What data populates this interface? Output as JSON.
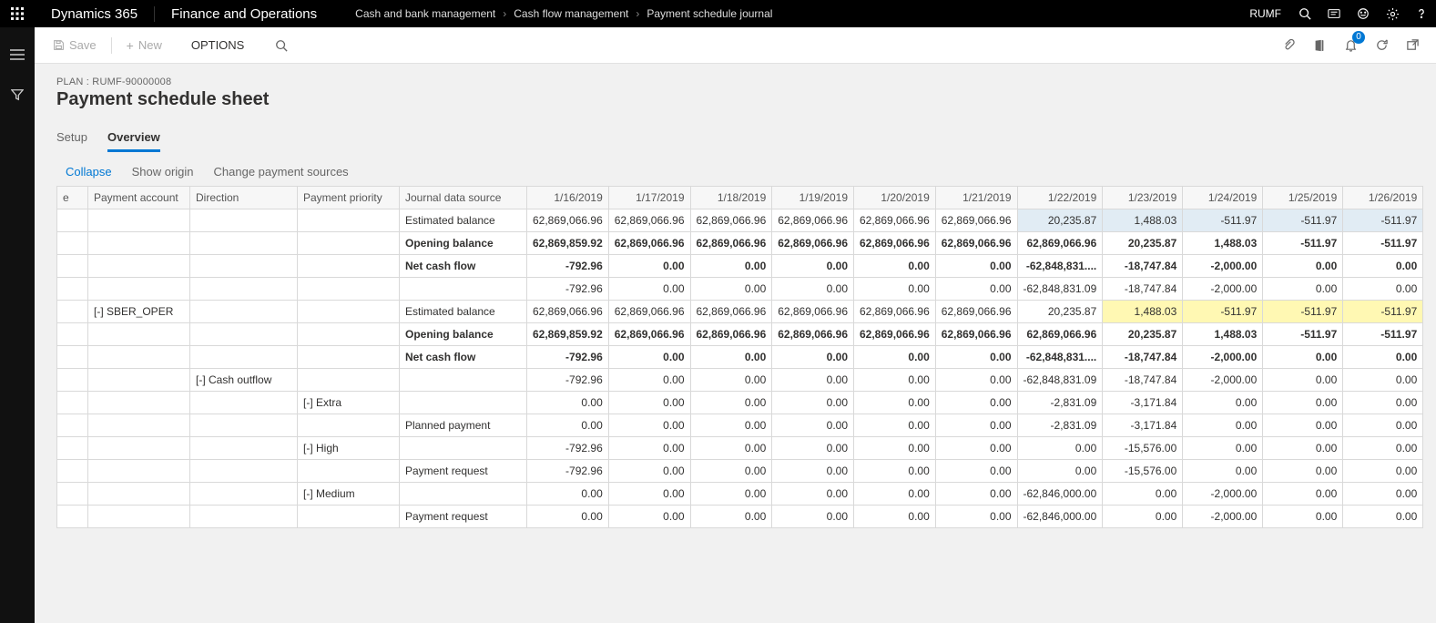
{
  "top": {
    "brand": "Dynamics 365",
    "suite": "Finance and Operations",
    "breadcrumb": [
      "Cash and bank management",
      "Cash flow management",
      "Payment schedule journal"
    ],
    "user": "RUMF"
  },
  "action": {
    "save": "Save",
    "new": "New",
    "options": "OPTIONS",
    "notif_count": "0"
  },
  "page": {
    "plan_line": "PLAN : RUMF-90000008",
    "title": "Payment schedule sheet"
  },
  "tabs": {
    "setup": "Setup",
    "overview": "Overview"
  },
  "tools": {
    "collapse": "Collapse",
    "show_origin": "Show origin",
    "change_sources": "Change payment sources"
  },
  "grid": {
    "headers": {
      "stub": "e",
      "payment_account": "Payment account",
      "direction": "Direction",
      "payment_priority": "Payment priority",
      "journal_source": "Journal data source"
    },
    "dates": [
      "1/16/2019",
      "1/17/2019",
      "1/18/2019",
      "1/19/2019",
      "1/20/2019",
      "1/21/2019",
      "1/22/2019",
      "1/23/2019",
      "1/24/2019",
      "1/25/2019",
      "1/26/2019"
    ],
    "rows": [
      {
        "bold": false,
        "acct": "",
        "dir": "",
        "prio": "",
        "src": "Estimated balance",
        "vals": [
          "62,869,066.96",
          "62,869,066.96",
          "62,869,066.96",
          "62,869,066.96",
          "62,869,066.96",
          "62,869,066.96",
          "20,235.87",
          "1,488.03",
          "-511.97",
          "-511.97",
          "-511.97"
        ],
        "hl": {
          "from": 6,
          "to": 10,
          "class": "hl-blue"
        }
      },
      {
        "bold": true,
        "acct": "",
        "dir": "",
        "prio": "",
        "src": "Opening balance",
        "vals": [
          "62,869,859.92",
          "62,869,066.96",
          "62,869,066.96",
          "62,869,066.96",
          "62,869,066.96",
          "62,869,066.96",
          "62,869,066.96",
          "20,235.87",
          "1,488.03",
          "-511.97",
          "-511.97"
        ]
      },
      {
        "bold": true,
        "acct": "",
        "dir": "",
        "prio": "",
        "src": "Net cash flow",
        "vals": [
          "-792.96",
          "0.00",
          "0.00",
          "0.00",
          "0.00",
          "0.00",
          "-62,848,831....",
          "-18,747.84",
          "-2,000.00",
          "0.00",
          "0.00"
        ]
      },
      {
        "bold": false,
        "acct": "",
        "dir": "",
        "prio": "",
        "src": "",
        "vals": [
          "-792.96",
          "0.00",
          "0.00",
          "0.00",
          "0.00",
          "0.00",
          "-62,848,831.09",
          "-18,747.84",
          "-2,000.00",
          "0.00",
          "0.00"
        ]
      },
      {
        "bold": false,
        "acct": "[-] SBER_OPER",
        "dir": "",
        "prio": "",
        "src": "Estimated balance",
        "vals": [
          "62,869,066.96",
          "62,869,066.96",
          "62,869,066.96",
          "62,869,066.96",
          "62,869,066.96",
          "62,869,066.96",
          "20,235.87",
          "1,488.03",
          "-511.97",
          "-511.97",
          "-511.97"
        ],
        "hl": {
          "from": 7,
          "to": 10,
          "class": "hl-yellow"
        }
      },
      {
        "bold": true,
        "acct": "",
        "dir": "",
        "prio": "",
        "src": "Opening balance",
        "vals": [
          "62,869,859.92",
          "62,869,066.96",
          "62,869,066.96",
          "62,869,066.96",
          "62,869,066.96",
          "62,869,066.96",
          "62,869,066.96",
          "20,235.87",
          "1,488.03",
          "-511.97",
          "-511.97"
        ]
      },
      {
        "bold": true,
        "acct": "",
        "dir": "",
        "prio": "",
        "src": "Net cash flow",
        "vals": [
          "-792.96",
          "0.00",
          "0.00",
          "0.00",
          "0.00",
          "0.00",
          "-62,848,831....",
          "-18,747.84",
          "-2,000.00",
          "0.00",
          "0.00"
        ]
      },
      {
        "bold": false,
        "acct": "",
        "dir": "[-] Cash outflow",
        "prio": "",
        "src": "",
        "vals": [
          "-792.96",
          "0.00",
          "0.00",
          "0.00",
          "0.00",
          "0.00",
          "-62,848,831.09",
          "-18,747.84",
          "-2,000.00",
          "0.00",
          "0.00"
        ]
      },
      {
        "bold": false,
        "acct": "",
        "dir": "",
        "prio": "[-] Extra",
        "src": "",
        "vals": [
          "0.00",
          "0.00",
          "0.00",
          "0.00",
          "0.00",
          "0.00",
          "-2,831.09",
          "-3,171.84",
          "0.00",
          "0.00",
          "0.00"
        ]
      },
      {
        "bold": false,
        "acct": "",
        "dir": "",
        "prio": "",
        "src": "Planned payment",
        "vals": [
          "0.00",
          "0.00",
          "0.00",
          "0.00",
          "0.00",
          "0.00",
          "-2,831.09",
          "-3,171.84",
          "0.00",
          "0.00",
          "0.00"
        ]
      },
      {
        "bold": false,
        "acct": "",
        "dir": "",
        "prio": "[-] High",
        "src": "",
        "vals": [
          "-792.96",
          "0.00",
          "0.00",
          "0.00",
          "0.00",
          "0.00",
          "0.00",
          "-15,576.00",
          "0.00",
          "0.00",
          "0.00"
        ]
      },
      {
        "bold": false,
        "acct": "",
        "dir": "",
        "prio": "",
        "src": "Payment request",
        "vals": [
          "-792.96",
          "0.00",
          "0.00",
          "0.00",
          "0.00",
          "0.00",
          "0.00",
          "-15,576.00",
          "0.00",
          "0.00",
          "0.00"
        ]
      },
      {
        "bold": false,
        "acct": "",
        "dir": "",
        "prio": "[-] Medium",
        "src": "",
        "vals": [
          "0.00",
          "0.00",
          "0.00",
          "0.00",
          "0.00",
          "0.00",
          "-62,846,000.00",
          "0.00",
          "-2,000.00",
          "0.00",
          "0.00"
        ]
      },
      {
        "bold": false,
        "acct": "",
        "dir": "",
        "prio": "",
        "src": "Payment request",
        "vals": [
          "0.00",
          "0.00",
          "0.00",
          "0.00",
          "0.00",
          "0.00",
          "-62,846,000.00",
          "0.00",
          "-2,000.00",
          "0.00",
          "0.00"
        ]
      }
    ]
  }
}
